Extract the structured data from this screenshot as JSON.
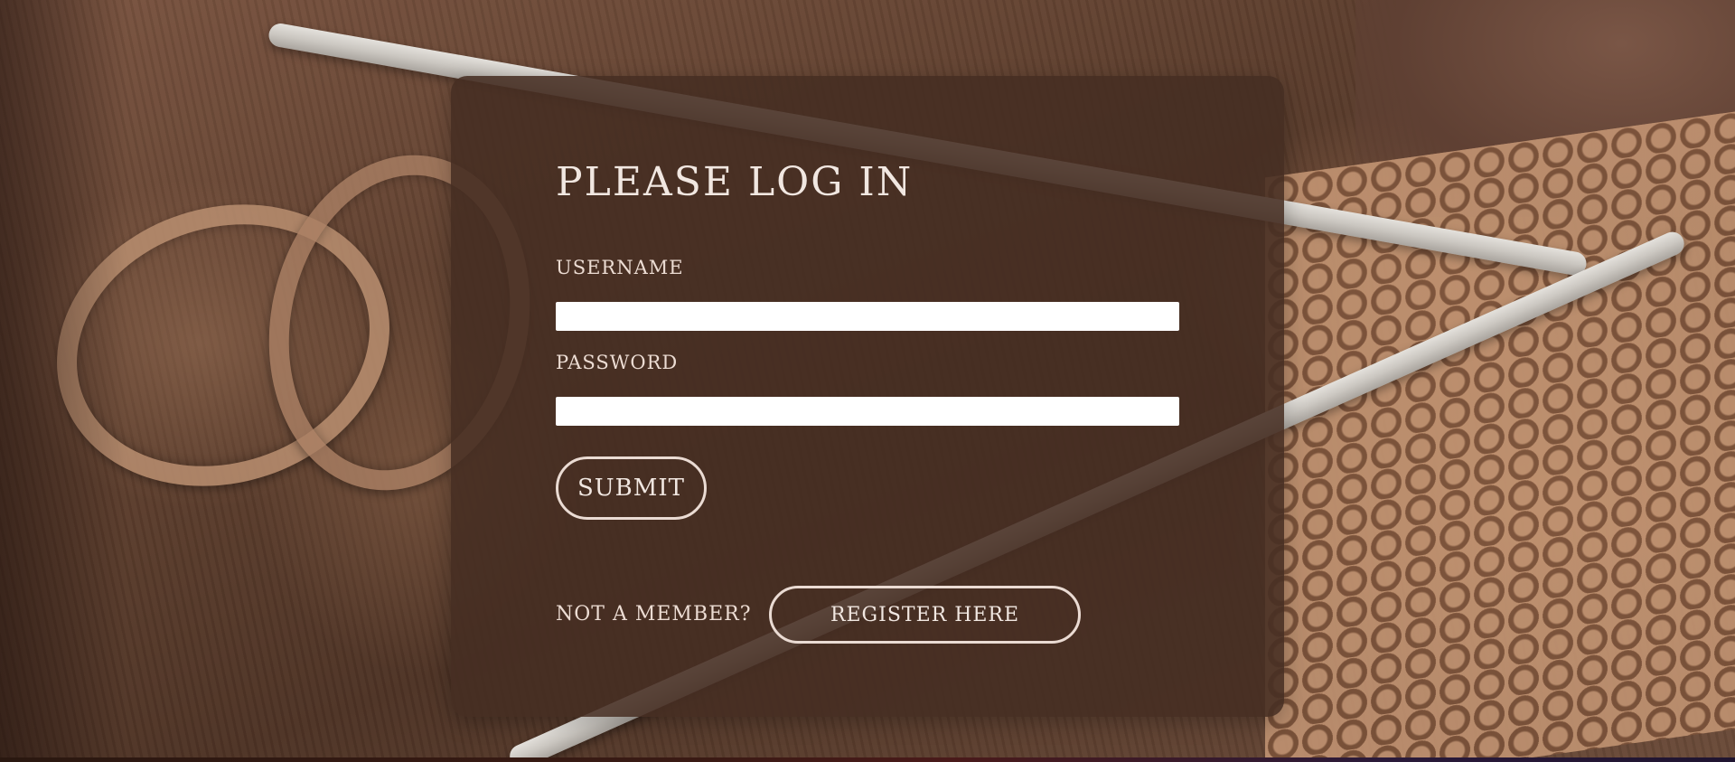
{
  "login": {
    "title": "PLEASE LOG IN",
    "username_label": "USERNAME",
    "username_value": "",
    "password_label": "PASSWORD",
    "password_value": "",
    "submit_label": "SUBMIT",
    "member_prompt": "NOT A MEMBER?",
    "register_label": "REGISTER HERE"
  },
  "colors": {
    "card_background": "#462d22",
    "text": "#f1e7e1",
    "button_border": "#eadbd3",
    "input_background": "#ffffff"
  }
}
